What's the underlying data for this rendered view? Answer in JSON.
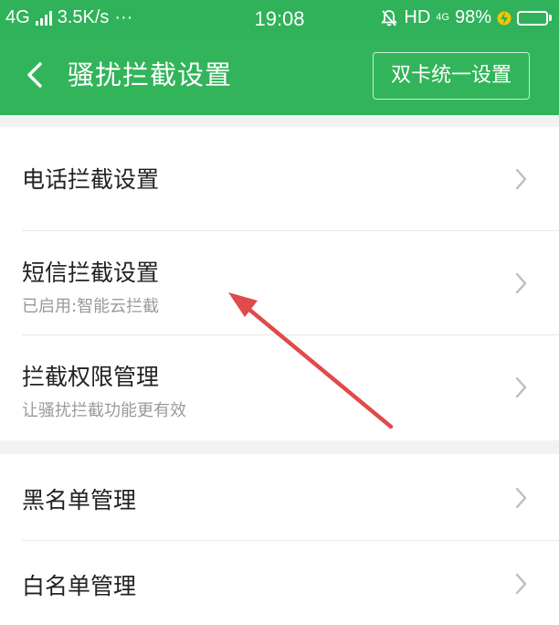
{
  "status_bar": {
    "network": "4G",
    "speed": "3.5K/s",
    "more": "···",
    "time": "19:08",
    "hd": "HD",
    "net_small": "4G",
    "battery_text": "98%",
    "battery_level": 0.98
  },
  "app_bar": {
    "title": "骚扰拦截设置",
    "dual_card_button": "双卡统一设置"
  },
  "group1": {
    "items": [
      {
        "title": "电话拦截设置",
        "subtitle": ""
      },
      {
        "title": "短信拦截设置",
        "subtitle": "已启用:智能云拦截"
      },
      {
        "title": "拦截权限管理",
        "subtitle": "让骚扰拦截功能更有效"
      }
    ]
  },
  "group2": {
    "items": [
      {
        "title": "黑名单管理"
      },
      {
        "title": "白名单管理"
      }
    ]
  },
  "colors": {
    "brand_green": "#32b45b",
    "annotation_red": "#e04a4a"
  }
}
